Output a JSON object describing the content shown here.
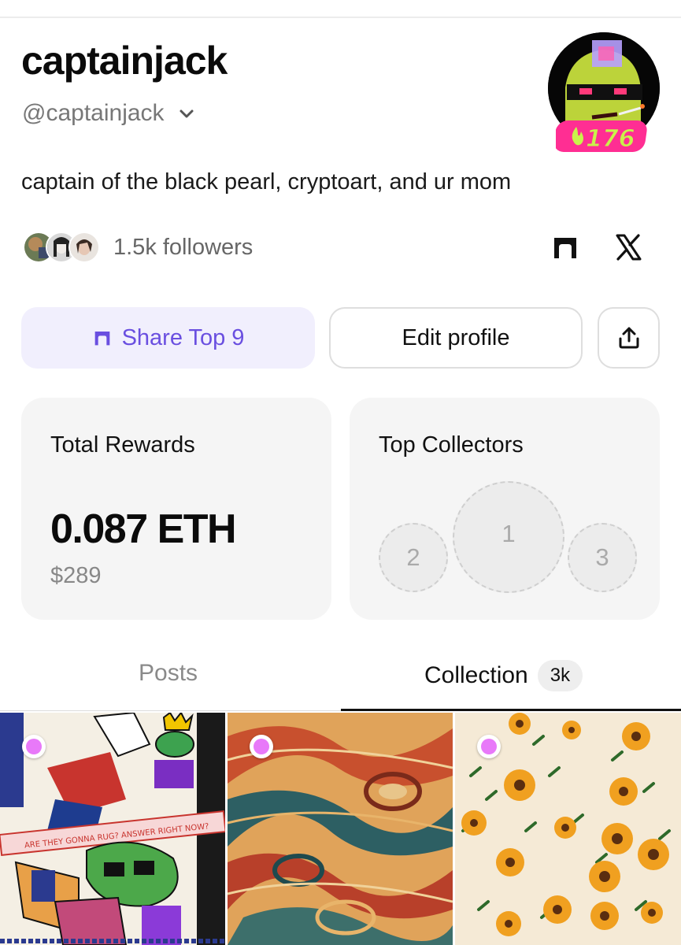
{
  "profile": {
    "display_name": "captainjack",
    "handle": "@captainjack",
    "bio": "captain of the black pearl, cryptoart, and ur mom",
    "followers_label": "1.5k followers",
    "avatar_badge": "176",
    "avatar_icon": "flame-icon"
  },
  "social": {
    "top9_icon": "arch-icon",
    "x_icon": "x-logo-icon"
  },
  "actions": {
    "share_label": "Share Top 9",
    "edit_label": "Edit profile",
    "upload_icon": "share-upload-icon"
  },
  "rewards": {
    "title": "Total Rewards",
    "eth": "0.087 ETH",
    "usd": "$289"
  },
  "collectors": {
    "title": "Top Collectors",
    "slots": [
      "1",
      "2",
      "3"
    ]
  },
  "tabs": {
    "posts": "Posts",
    "collection": "Collection",
    "collection_count": "3k"
  },
  "gallery": {
    "caption": "ARE THEY GONNA RUG? ANSWER RIGHT NOW?",
    "dot_color": "#e879f9"
  },
  "colors": {
    "accent": "#6a4fe0",
    "accent_bg": "#f1effd",
    "muted": "#888888",
    "card_bg": "#f5f5f5",
    "badge_pink": "#ff2e93",
    "badge_green": "#c9f24b"
  }
}
